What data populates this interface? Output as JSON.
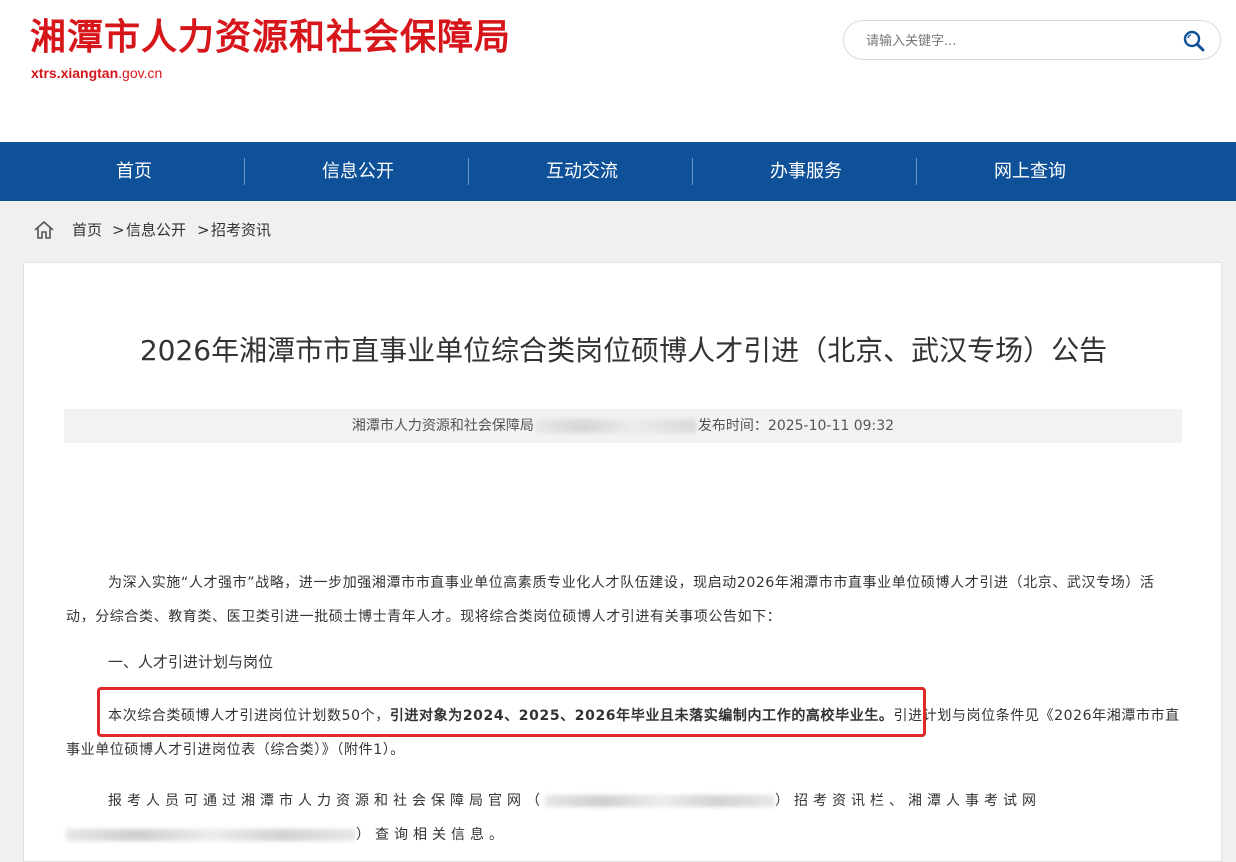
{
  "header": {
    "site_title": "湘潭市人力资源和社会保障局",
    "url_bold": "xtrs.xiangtan",
    "url_rest": ".gov.cn",
    "search_placeholder": "请输入关键字..."
  },
  "nav": {
    "items": [
      {
        "label": "首页"
      },
      {
        "label": "信息公开"
      },
      {
        "label": "互动交流"
      },
      {
        "label": "办事服务"
      },
      {
        "label": "网上查询"
      }
    ]
  },
  "breadcrumb": {
    "home": "首页",
    "sep": ">",
    "level2": "信息公开",
    "level3": "招考资讯"
  },
  "article": {
    "title": "2026年湘潭市市直事业单位综合类岗位硕博人才引进（北京、武汉专场）公告",
    "meta_source": "湘潭市人力资源和社会保障局",
    "meta_publish_label": "发布时间：",
    "meta_publish_time": "2025-10-11 09:32",
    "p1": "为深入实施“人才强市”战略，进一步加强湘潭市市直事业单位高素质专业化人才队伍建设，现启动2026年湘潭市市直事业单位硕博人才引进（北京、武汉专场）活动，分综合类、教育类、医卫类引进一批硕士博士青年人才。现将综合类岗位硕博人才引进有关事项公告如下：",
    "heading1": "一、人才引进计划与岗位",
    "p2_normal": "本次综合类硕博人才引进岗位计划数50个，",
    "p2_bold": "引进对象为2024、2025、2026年毕业且未落实编制内工作的高校毕业生。",
    "p2_rest": "引进计划与岗位条件见《2026年湘潭市市直事业单位硕博人才引进岗位表（综合类）》（附件1）。",
    "p3_start": "报考人员可通过湘潭市人力资源和社会保障局官网（",
    "p3_mid": "）招考资讯栏、湘潭人事考试网",
    "p3_end": "）查询相关信息。"
  },
  "colors": {
    "brand_red": "#d7161b",
    "nav_blue": "#0e5198",
    "highlight_red": "#e0292b"
  }
}
